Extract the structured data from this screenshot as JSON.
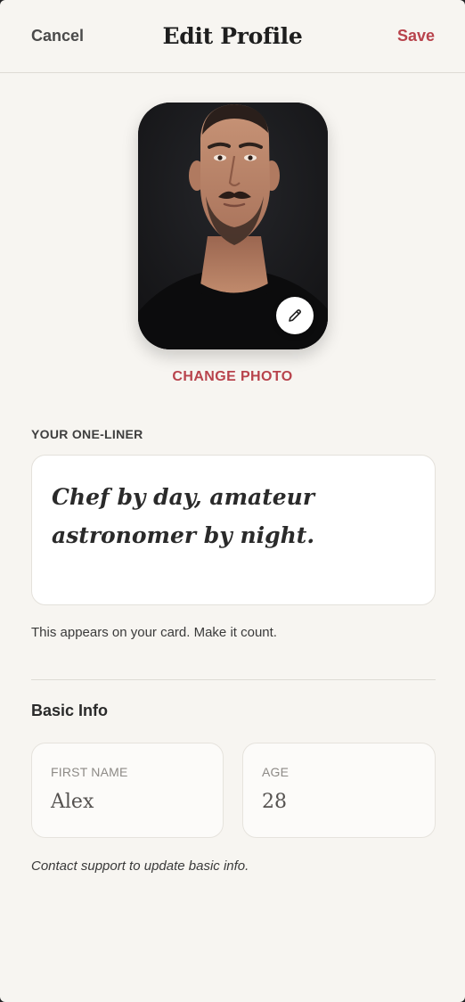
{
  "header": {
    "cancel_label": "Cancel",
    "title": "Edit Profile",
    "save_label": "Save"
  },
  "photo": {
    "change_label": "CHANGE PHOTO",
    "edit_icon": "pencil-icon"
  },
  "one_liner": {
    "label": "YOUR ONE-LINER",
    "value": "Chef by day, amateur astronomer by night.",
    "helper": "This appears on your card. Make it count."
  },
  "basic_info": {
    "title": "Basic Info",
    "first_name_label": "FIRST NAME",
    "first_name_value": "Alex",
    "age_label": "AGE",
    "age_value": "28",
    "note": "Contact support to update basic info."
  },
  "colors": {
    "accent": "#b8434c",
    "background": "#f7f5f1",
    "card": "#ffffff"
  }
}
